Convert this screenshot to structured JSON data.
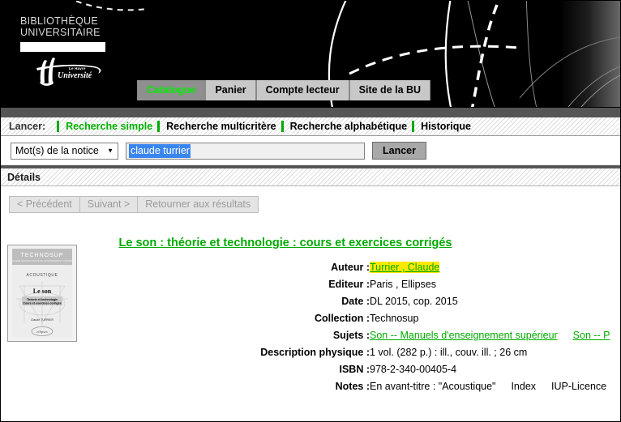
{
  "header": {
    "logo": {
      "line1": "BIBLIOTHÈQUE",
      "line2": "UNIVERSITAIRE",
      "univ_small": "Le Havre",
      "univ_name": "Université"
    },
    "tabs": [
      {
        "label": "Catalogue",
        "active": true
      },
      {
        "label": "Panier",
        "active": false
      },
      {
        "label": "Compte lecteur",
        "active": false
      },
      {
        "label": "Site de la BU",
        "active": false
      }
    ]
  },
  "lancer_bar": {
    "label": "Lancer:",
    "items": [
      {
        "label": "Recherche simple",
        "active": true
      },
      {
        "label": "Recherche multicritère",
        "active": false
      },
      {
        "label": "Recherche alphabétique",
        "active": false
      },
      {
        "label": "Historique",
        "active": false
      }
    ]
  },
  "search": {
    "field_select_value": "Mot(s) de la notice",
    "query_value": "claude turrier",
    "query_placeholder": "",
    "submit_label": "Lancer"
  },
  "details_header": {
    "title": "Détails"
  },
  "nav_buttons": [
    {
      "label": "< Précédent",
      "disabled": true
    },
    {
      "label": "Suivant >",
      "disabled": true
    },
    {
      "label": "Retourner aux résultats",
      "disabled": true
    }
  ],
  "record": {
    "title": "Le son : théorie et technologie : cours et exercices corrigés",
    "cover": {
      "series": "TECHNOSUP",
      "series_sub": "LA FILIÈRE TECHNOLOGIQUE DE L'ENSEIGNEMENT SUPÉRIEUR",
      "domain": "ACOUSTIQUE",
      "title": "Le son",
      "sub1": "Théorie et technologie",
      "sub2": "Cours et exercices corrigés",
      "author": "Claude TURRIER",
      "publisher": "ellipses"
    },
    "fields": [
      {
        "label": "Auteur :",
        "type": "highlight-link",
        "value": "Turrier , Claude"
      },
      {
        "label": "Editeur :",
        "type": "text",
        "value": "Paris , Ellipses"
      },
      {
        "label": "Date :",
        "type": "text",
        "value": "DL 2015, cop. 2015"
      },
      {
        "label": "Collection :",
        "type": "text",
        "value": "Technosup"
      },
      {
        "label": "Sujets :",
        "type": "links",
        "links": [
          "Son -- Manuels d'enseignement supérieur",
          "Son -- P"
        ]
      },
      {
        "label": "Description physique :",
        "type": "text",
        "value": "1 vol. (282 p.) : ill., couv. ill. ; 26 cm"
      },
      {
        "label": "ISBN :",
        "type": "text",
        "value": "978-2-340-00405-4"
      },
      {
        "label": "Notes :",
        "type": "notes",
        "notes": [
          "En avant-titre : \"Acoustique\"",
          "Index",
          "IUP-Licence"
        ]
      }
    ]
  },
  "colors": {
    "green_accent": "#00aa00",
    "tab_active_green": "#00ee00",
    "highlight_yellow": "#ffe800",
    "selection_blue": "#3a86f0",
    "header_black": "#000000",
    "strip_gray": "#555555"
  }
}
